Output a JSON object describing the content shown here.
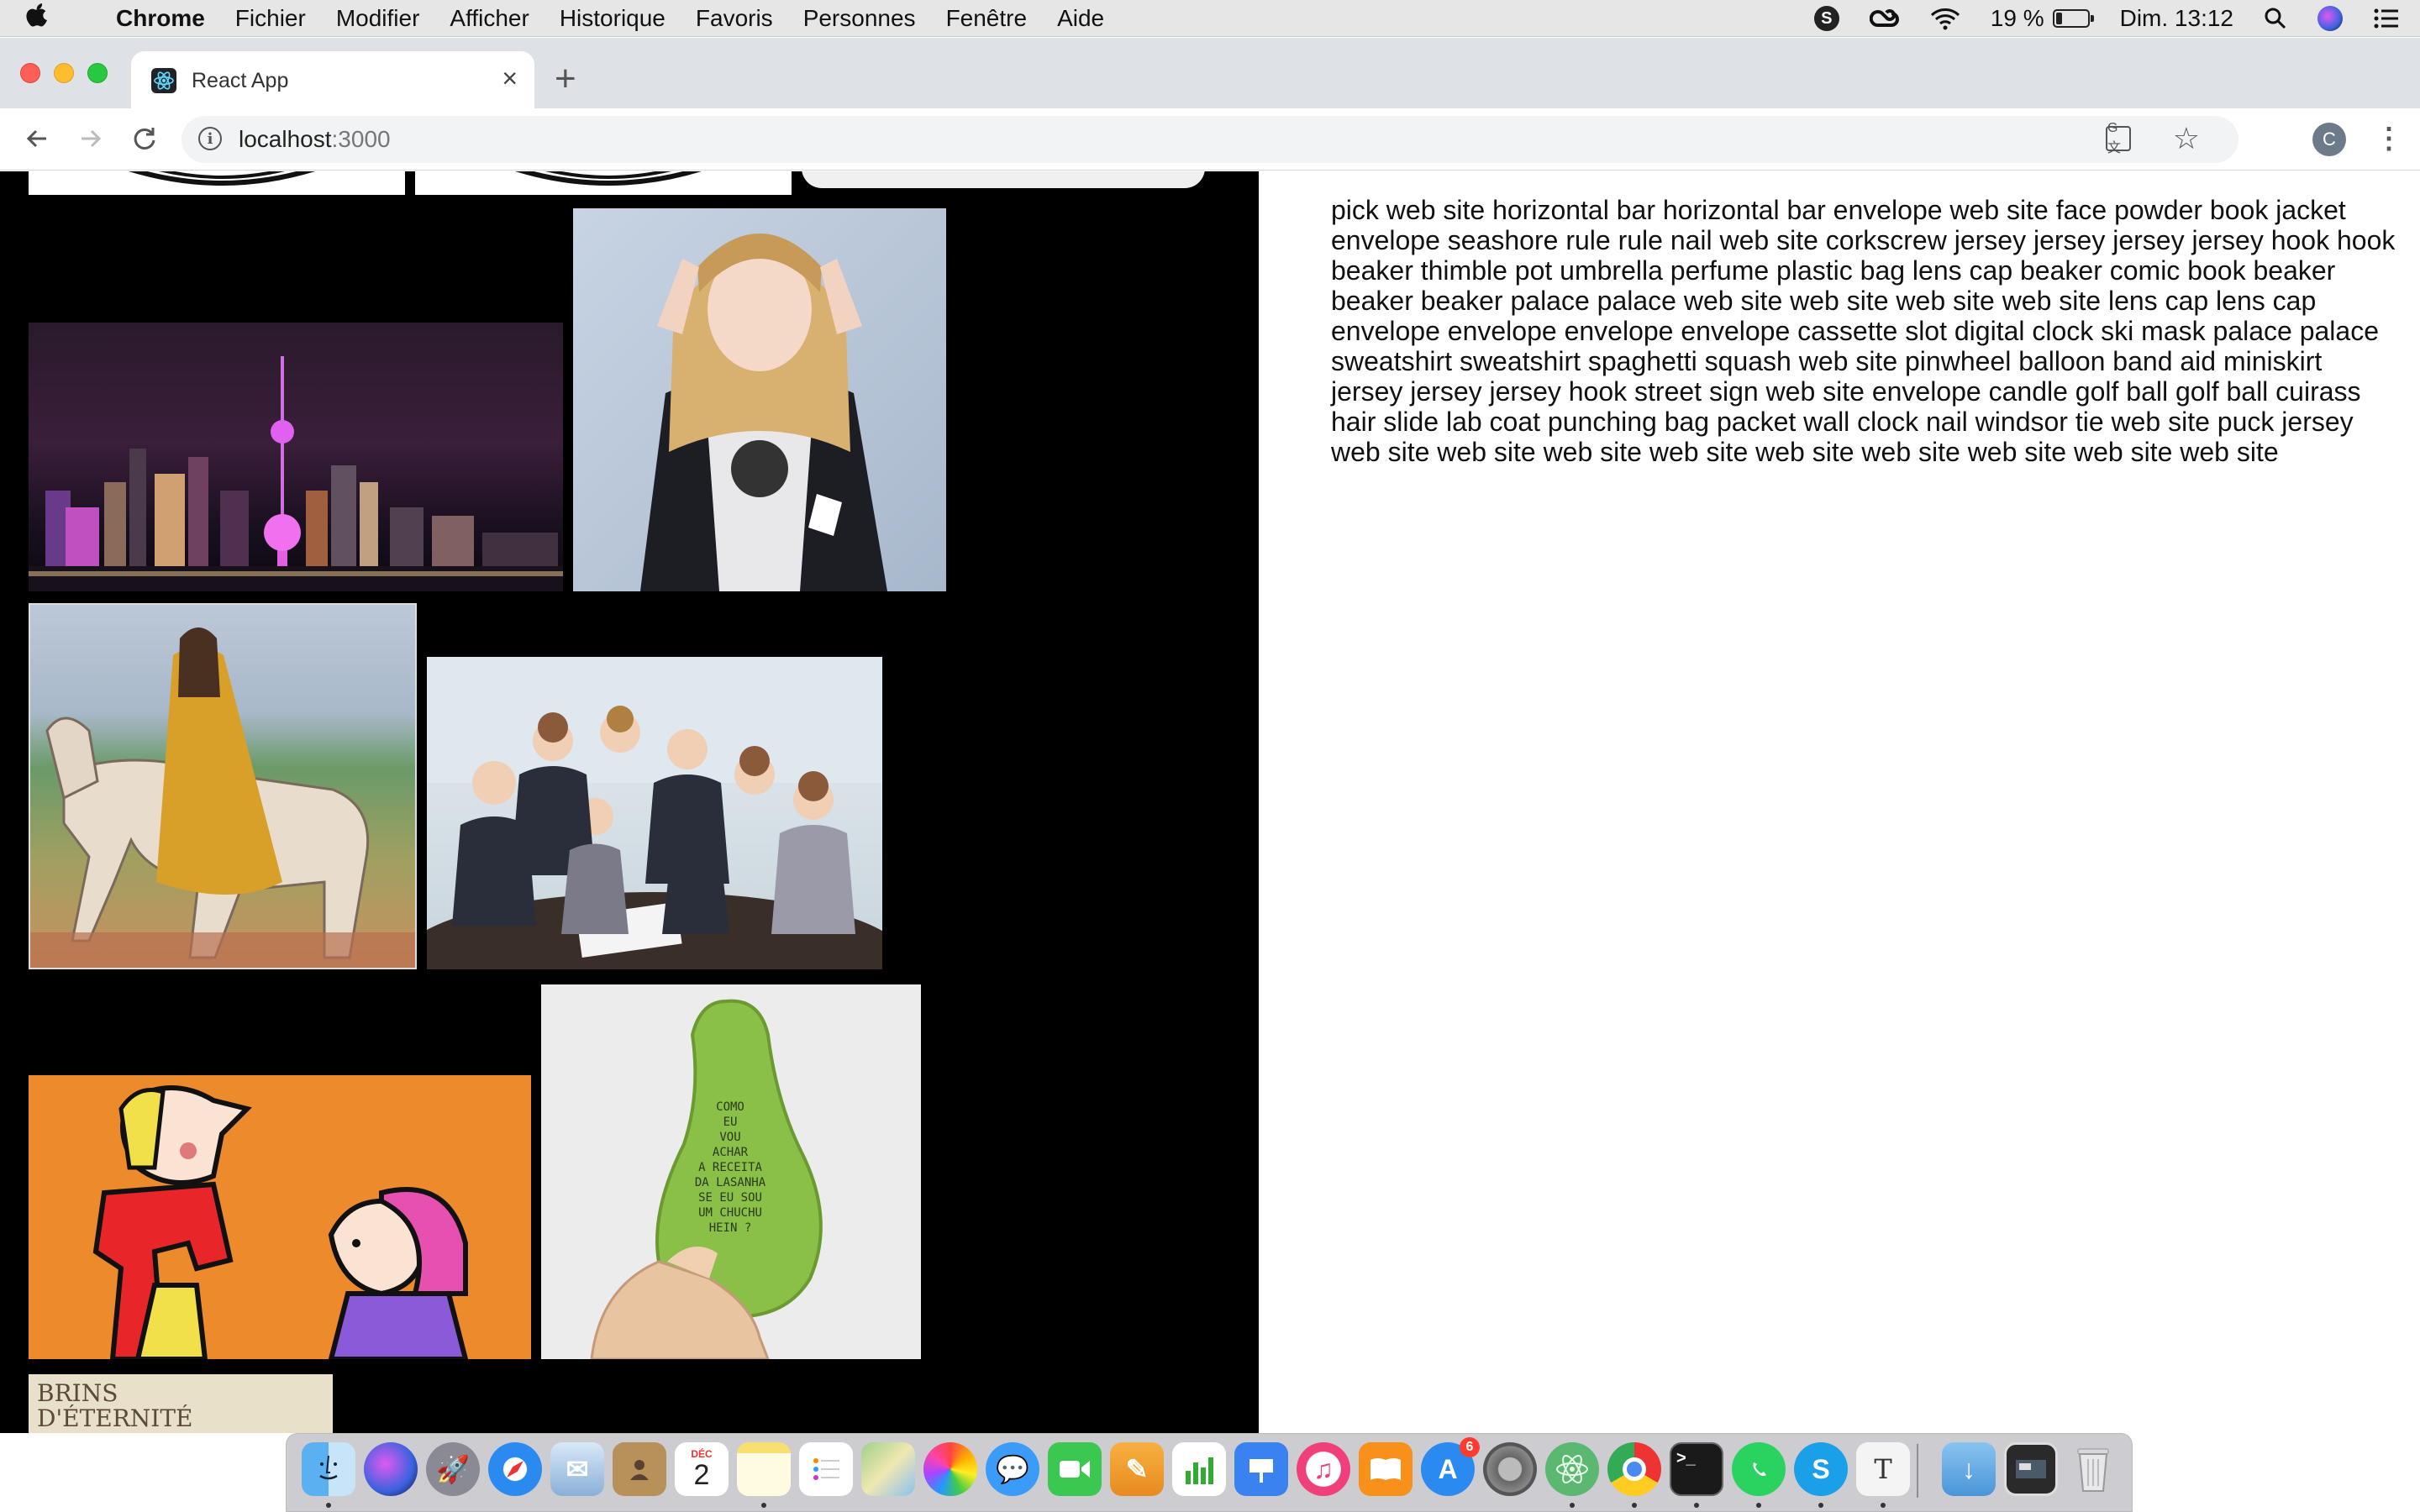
{
  "menubar": {
    "app_name": "Chrome",
    "menus": [
      "Fichier",
      "Modifier",
      "Afficher",
      "Historique",
      "Favoris",
      "Personnes",
      "Fenêtre",
      "Aide"
    ],
    "battery_percent": "19 %",
    "battery_level": 0.19,
    "clock": "Dim. 13:12"
  },
  "browser": {
    "tab_title": "React App",
    "url_host": "localhost",
    "url_port": ":3000",
    "profile_initial": "C"
  },
  "gallery": {
    "background": "#000000",
    "images": [
      {
        "name": "top-cropped-image-1",
        "description": "cropped image"
      },
      {
        "name": "top-cropped-image-2",
        "description": "cropped image"
      },
      {
        "name": "top-cropped-image-3",
        "description": "cropped image"
      },
      {
        "name": "city-skyline-image",
        "description": "night city skyline with tower"
      },
      {
        "name": "person-photo-image",
        "description": "person making peace signs"
      },
      {
        "name": "medieval-painting-image",
        "description": "woman riding a horse painting"
      },
      {
        "name": "office-team-image",
        "description": "office team thumbs up"
      },
      {
        "name": "cartoon-image",
        "description": "cartoon characters on orange"
      },
      {
        "name": "vegetable-image",
        "description": "hand holding a chayote with writing"
      },
      {
        "name": "bottom-cropped-image",
        "description": "cropped image with text"
      }
    ],
    "bottom_image_text": "BRINS\nD'ÉTERNITÉ"
  },
  "word_list": "pick web site horizontal bar horizontal bar envelope web site face powder book jacket envelope seashore rule rule nail web site corkscrew jersey jersey jersey jersey hook hook beaker thimble pot umbrella perfume plastic bag lens cap beaker comic book beaker beaker beaker palace palace web site web site web site web site lens cap lens cap envelope envelope envelope envelope cassette slot digital clock ski mask palace palace sweatshirt sweatshirt spaghetti squash web site pinwheel balloon band aid miniskirt jersey jersey jersey hook street sign web site envelope candle golf ball golf ball cuirass hair slide lab coat punching bag packet wall clock nail windsor tie web site puck jersey web site web site web site web site web site web site web site web site web site",
  "dock": {
    "calendar_day": "2",
    "calendar_month": "DÉC",
    "app_store_badge": "6",
    "apps": [
      "finder",
      "siri",
      "launchpad",
      "safari",
      "mail",
      "contacts",
      "calendar",
      "notes",
      "reminders",
      "maps",
      "photos",
      "messages",
      "facetime",
      "pages",
      "numbers",
      "keynote",
      "itunes",
      "books",
      "app-store",
      "system-preferences",
      "atom",
      "chrome",
      "terminal",
      "whatsapp",
      "skype",
      "typora",
      "downloads",
      "screenshot",
      "trash"
    ]
  }
}
